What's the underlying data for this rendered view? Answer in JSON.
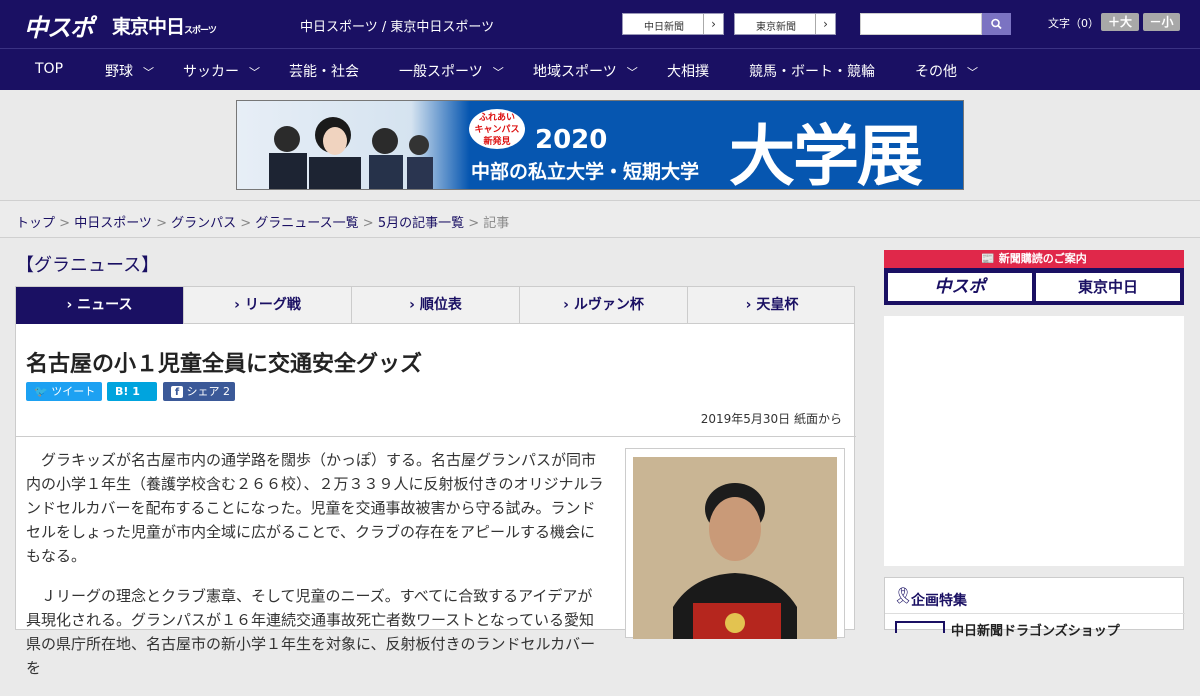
{
  "header": {
    "logo_main": "中スポ",
    "logo_tokyo": "東京中日",
    "logo_tokyo_small": "スポーツ",
    "site_links": "中日スポーツ / 東京中日スポーツ",
    "ext_links": [
      "中日新聞",
      "東京新聞"
    ],
    "font_size_label": "文字（0）",
    "font_plus": "＋大",
    "font_minus": "－小"
  },
  "nav": {
    "items": [
      {
        "label": "TOP",
        "has_menu": false
      },
      {
        "label": "野球",
        "has_menu": true
      },
      {
        "label": "サッカー",
        "has_menu": true
      },
      {
        "label": "芸能・社会",
        "has_menu": false
      },
      {
        "label": "一般スポーツ",
        "has_menu": true
      },
      {
        "label": "地域スポーツ",
        "has_menu": true
      },
      {
        "label": "大相撲",
        "has_menu": false
      },
      {
        "label": "競馬・ボート・競輪",
        "has_menu": false
      },
      {
        "label": "その他",
        "has_menu": true
      }
    ]
  },
  "banner": {
    "badge": "ふれあい\nキャンパス\n新発見",
    "year": "2020",
    "subtitle": "中部の私立大学・短期大学",
    "big": "大学展"
  },
  "breadcrumb": {
    "items": [
      "トップ",
      "中日スポーツ",
      "グランパス",
      "グラニュース一覧",
      "5月の記事一覧"
    ],
    "current": "記事"
  },
  "section_label": "【グラニュース】",
  "tabs": [
    "ニュース",
    "リーグ戦",
    "順位表",
    "ルヴァン杯",
    "天皇杯"
  ],
  "article": {
    "title": "名古屋の小１児童全員に交通安全グッズ",
    "share": {
      "tweet": "ツイート",
      "hatena": "1",
      "facebook": "シェア 2"
    },
    "dateline": "2019年5月30日 紙面から",
    "paragraphs": [
      "グラキッズが名古屋市内の通学路を闊歩（かっぽ）する。名古屋グランパスが同市内の小学１年生（養護学校含む２６６校）、２万３３９人に反射板付きのオリジナルランドセルカバーを配布することになった。児童を交通事故被害から守る試み。ランドセルをしょった児童が市内全域に広がることで、クラブの存在をアピールする機会にもなる。",
      "Ｊリーグの理念とクラブ憲章、そして児童のニーズ。すべてに合致するアイデアが具現化される。グランパスが１６年連続交通事故死亡者数ワーストとなっている愛知県の県庁所在地、名古屋市の新小学１年生を対象に、反射板付きのランドセルカバーを"
    ]
  },
  "sidebar": {
    "subscribe_title": "新聞購読のご案内",
    "subscribe_logos": [
      "中スポ",
      "東京中日"
    ],
    "features_title": "企画特集",
    "features_item": "中日新聞ドラゴンズショップ"
  },
  "colors": {
    "brand": "#1a1063",
    "accent_red": "#e0284a",
    "twitter": "#1da1f2",
    "hatena": "#00a4de",
    "facebook": "#3b5998"
  }
}
